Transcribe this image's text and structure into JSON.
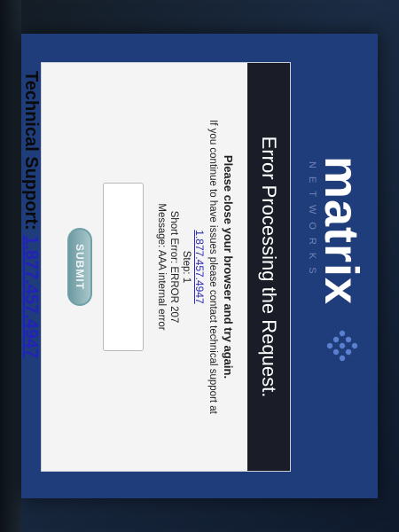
{
  "brand": {
    "logo_text": "matrix",
    "tagline": "NETWORKS"
  },
  "dialog": {
    "title": "Error Processing the Request.",
    "lead": "Please close your browser and try again.",
    "contact_text": "If you continue to have issues please contact technical support at",
    "phone": "1.877.457.4947",
    "step": "Step: 1",
    "short_error": "Short Error: ERROR 207",
    "message": "Message: AAA internal error",
    "input_value": "",
    "submit_label": "SUBMIT"
  },
  "support": {
    "label": "Technical Support:",
    "phone": "1.877.457.4947"
  },
  "colors": {
    "screen_background": "#1f3d7a",
    "title_bar": "#1a1d27",
    "link": "#2b2bb8",
    "button": "#6e9aa1"
  }
}
